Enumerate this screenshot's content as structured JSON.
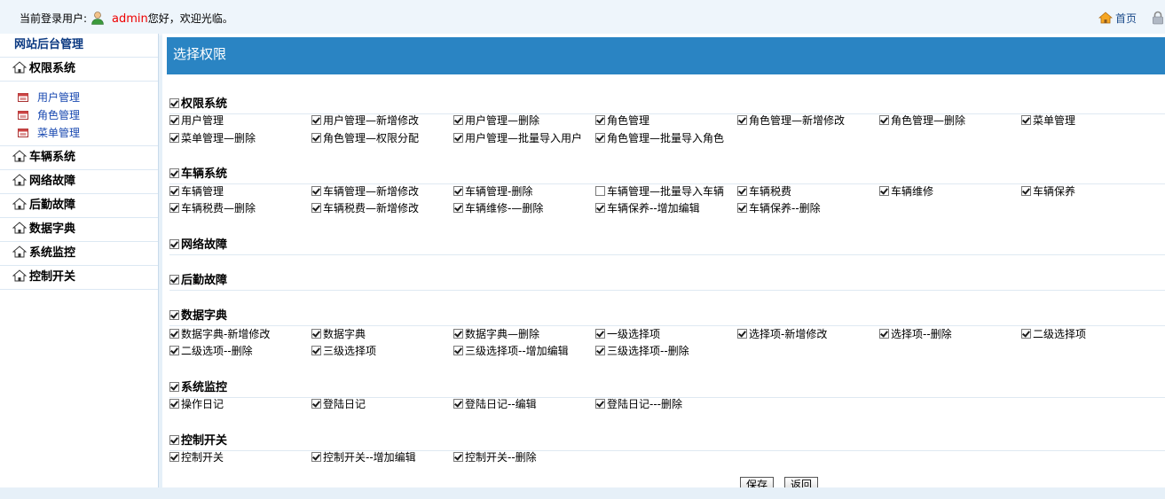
{
  "top": {
    "login_prefix": "当前登录用户:",
    "username": "admin",
    "welcome": "您好，欢迎光临。",
    "home_label": "首页"
  },
  "sidebar": {
    "title": "网站后台管理",
    "groups": [
      {
        "label": "权限系统",
        "items": [
          "用户管理",
          "角色管理",
          "菜单管理"
        ]
      },
      {
        "label": "车辆系统"
      },
      {
        "label": "网络故障"
      },
      {
        "label": "后勤故障"
      },
      {
        "label": "数据字典"
      },
      {
        "label": "系统监控"
      },
      {
        "label": "控制开关"
      }
    ]
  },
  "main": {
    "header": "选择权限",
    "sections": [
      {
        "title": "权限系统",
        "checked": true,
        "rows": [
          [
            {
              "label": "用户管理",
              "checked": true
            },
            {
              "label": "用户管理—新增修改",
              "checked": true
            },
            {
              "label": "用户管理—删除",
              "checked": true
            },
            {
              "label": "角色管理",
              "checked": true
            },
            {
              "label": "角色管理—新增修改",
              "checked": true
            },
            {
              "label": "角色管理—删除",
              "checked": true
            },
            {
              "label": "菜单管理",
              "checked": true
            }
          ],
          [
            {
              "label": "菜单管理—删除",
              "checked": true
            },
            {
              "label": "角色管理—权限分配",
              "checked": true
            },
            {
              "label": "用户管理—批量导入用户",
              "checked": true
            },
            {
              "label": "角色管理—批量导入角色",
              "checked": true
            }
          ]
        ]
      },
      {
        "title": "车辆系统",
        "checked": true,
        "rows": [
          [
            {
              "label": "车辆管理",
              "checked": true
            },
            {
              "label": "车辆管理—新增修改",
              "checked": true
            },
            {
              "label": "车辆管理-删除",
              "checked": true
            },
            {
              "label": "车辆管理—批量导入车辆",
              "checked": false
            },
            {
              "label": "车辆税费",
              "checked": true
            },
            {
              "label": "车辆维修",
              "checked": true
            },
            {
              "label": "车辆保养",
              "checked": true
            }
          ],
          [
            {
              "label": "车辆税费—删除",
              "checked": true
            },
            {
              "label": "车辆税费—新增修改",
              "checked": true
            },
            {
              "label": "车辆维修-—删除",
              "checked": true
            },
            {
              "label": "车辆保养--增加编辑",
              "checked": true
            },
            {
              "label": "车辆保养--删除",
              "checked": true
            }
          ]
        ]
      },
      {
        "title": "网络故障",
        "checked": true,
        "rows": []
      },
      {
        "title": "后勤故障",
        "checked": true,
        "rows": []
      },
      {
        "title": "数据字典",
        "checked": true,
        "rows": [
          [
            {
              "label": "数据字典-新增修改",
              "checked": true
            },
            {
              "label": "数据字典",
              "checked": true
            },
            {
              "label": "数据字典—删除",
              "checked": true
            },
            {
              "label": "一级选择项",
              "checked": true
            },
            {
              "label": "选择项-新增修改",
              "checked": true
            },
            {
              "label": "选择项--删除",
              "checked": true
            },
            {
              "label": "二级选择项",
              "checked": true
            }
          ],
          [
            {
              "label": "二级选项--删除",
              "checked": true
            },
            {
              "label": "三级选择项",
              "checked": true
            },
            {
              "label": "三级选择项--增加编辑",
              "checked": true
            },
            {
              "label": "三级选择项--删除",
              "checked": true
            }
          ]
        ]
      },
      {
        "title": "系统监控",
        "checked": true,
        "rows": [
          [
            {
              "label": "操作日记",
              "checked": true
            },
            {
              "label": "登陆日记",
              "checked": true
            },
            {
              "label": "登陆日记--编辑",
              "checked": true
            },
            {
              "label": "登陆日记---删除",
              "checked": true
            }
          ]
        ]
      },
      {
        "title": "控制开关",
        "checked": true,
        "rows": [
          [
            {
              "label": "控制开关",
              "checked": true
            },
            {
              "label": "控制开关--增加编辑",
              "checked": true
            },
            {
              "label": "控制开关--删除",
              "checked": true
            }
          ]
        ]
      }
    ],
    "save_label": "保存",
    "back_label": "返回"
  }
}
